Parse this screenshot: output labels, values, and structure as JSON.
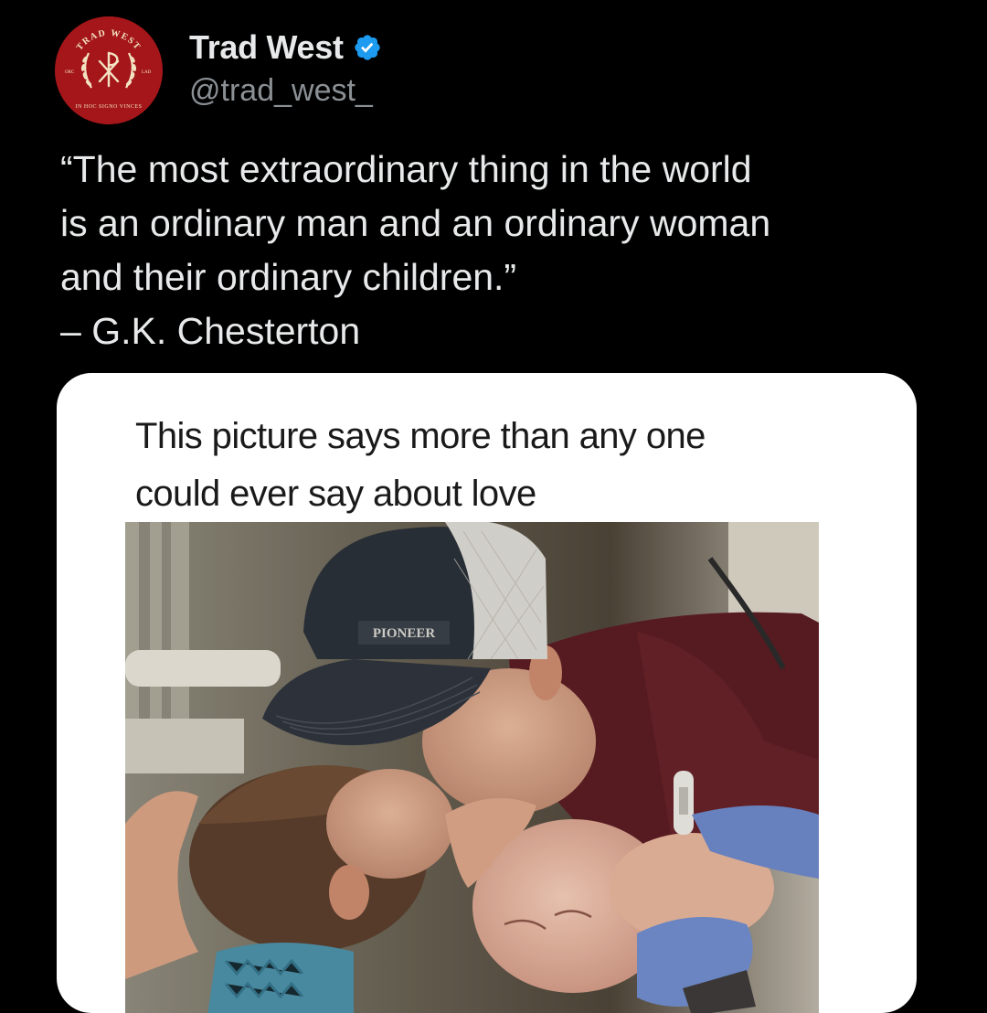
{
  "author": {
    "display_name": "Trad West",
    "handle": "@trad_west_",
    "avatar_icon": "trad-west-seal-logo",
    "avatar_color": "#a4161a",
    "verified_icon": "verified-badge-icon",
    "verified_color": "#1d9bf0",
    "avatar_text": {
      "top": "TRAD WEST",
      "left": "ORC",
      "right": "LAD",
      "bottom": "IN HOC SIGNO VINCES"
    }
  },
  "tweet": {
    "lines": [
      "“The most extraordinary thing in the world",
      "is an ordinary man and an ordinary woman",
      "and their ordinary children.”",
      "– G.K. Chesterton"
    ]
  },
  "media": {
    "caption_lines": [
      "This picture says more than any one",
      "could ever say about love"
    ],
    "photo_icon": "family-newborn-photo",
    "cap_text": "PIONEER"
  }
}
